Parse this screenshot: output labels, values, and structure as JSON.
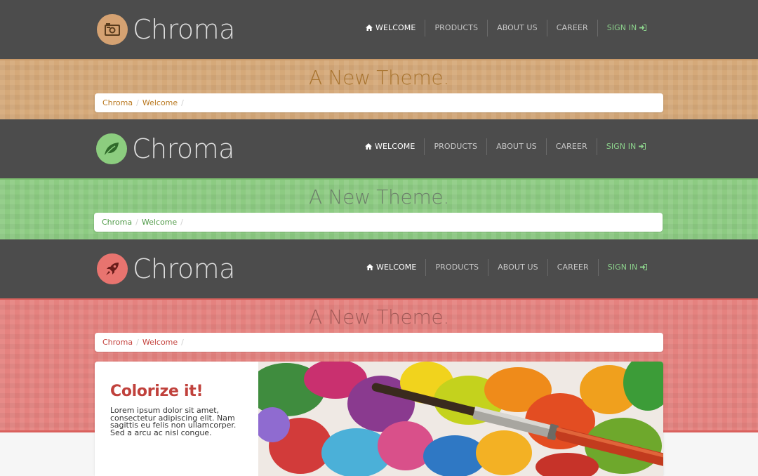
{
  "variants": [
    {
      "logo": {
        "icon": "camera-icon",
        "color": "#d5a272",
        "text": "Chroma"
      },
      "nav": [
        "Welcome",
        "Products",
        "About Us",
        "Career",
        "Sign In"
      ],
      "banner": {
        "title": "A New Theme.",
        "color": "#d5a979",
        "title_color": "#a8742f"
      },
      "breadcrumb": [
        "Chroma",
        "Welcome"
      ],
      "link_color": "#b9781f"
    },
    {
      "logo": {
        "icon": "leaf-icon",
        "color": "#8ccd7f",
        "text": "Chroma"
      },
      "nav": [
        "Welcome",
        "Products",
        "About Us",
        "Career",
        "Sign In"
      ],
      "banner": {
        "title": "A New Theme.",
        "color": "#8dcb82",
        "title_color": "#6c7e6a"
      },
      "breadcrumb": [
        "Chroma",
        "Welcome"
      ],
      "link_color": "#4f9a47"
    },
    {
      "logo": {
        "icon": "rocket-icon",
        "color": "#e8746f",
        "text": "Chroma"
      },
      "nav": [
        "Welcome",
        "Products",
        "About Us",
        "Career",
        "Sign In"
      ],
      "banner": {
        "title": "A New Theme.",
        "color": "#e5827f",
        "title_color": "#a15a57"
      },
      "breadcrumb": [
        "Chroma",
        "Welcome"
      ],
      "link_color": "#c4433e"
    }
  ],
  "card": {
    "heading": "Colorize it!",
    "body": "Lorem ipsum dolor sit amet, consectetur adipiscing elit. Nam sagittis eu felis non ullamcorper. Sed a arcu ac nisl congue.",
    "image": "paint-palette-brush-photo"
  }
}
